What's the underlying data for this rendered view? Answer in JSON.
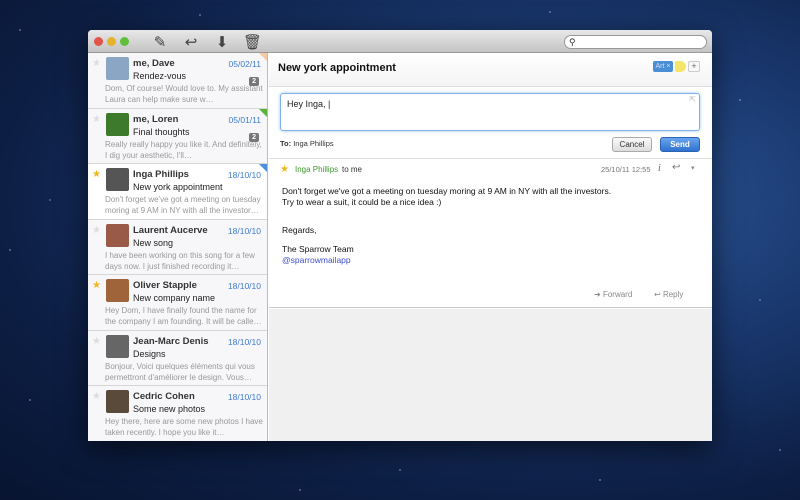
{
  "toolbar": {
    "icons": [
      "compose-icon",
      "reply-icon",
      "archive-icon",
      "trash-icon"
    ],
    "search_placeholder": ""
  },
  "messages": [
    {
      "from": "me, Dave",
      "date": "05/02/11",
      "subject": "Rendez-vous",
      "preview": "Dom, Of course! Would love to. My assistant Laura can help make sure w…",
      "count": "2",
      "starred": false,
      "flag": "#f4c9a3",
      "avatar": "#8aa6c4"
    },
    {
      "from": "me, Loren",
      "date": "05/01/11",
      "subject": "Final thoughts",
      "preview": "Really really happy you like it. And definitely, I dig your aesthetic, I'll…",
      "count": "2",
      "starred": false,
      "flag": "#58b33c",
      "avatar": "#3d7a2c"
    },
    {
      "from": "Inga Phillips",
      "date": "18/10/10",
      "subject": "New york appointment",
      "preview": "Don't forget we've got a meeting on tuesday moring at 9 AM in NY with all the investor…",
      "starred": true,
      "flag": "#4a90e2",
      "avatar": "#555",
      "selected": true
    },
    {
      "from": "Laurent Aucerve",
      "date": "18/10/10",
      "subject": "New song",
      "preview": "I have been working on this song for a few days now. I just finished recording it…",
      "starred": false,
      "avatar": "#9a5a48"
    },
    {
      "from": "Oliver Stapple",
      "date": "18/10/10",
      "subject": "New company name",
      "preview": "Hey Dom, I have finally found the name for the company I am founding. It will be calle…",
      "starred": true,
      "avatar": "#a0643a"
    },
    {
      "from": "Jean-Marc Denis",
      "date": "18/10/10",
      "subject": "Designs",
      "preview": "Bonjour, Voici quelques éléments qui vous permettront d'améliorer le design. Vous…",
      "starred": false,
      "avatar": "#666"
    },
    {
      "from": "Cedric Cohen",
      "date": "18/10/10",
      "subject": "Some new photos",
      "preview": "Hey there, here are some new photos I have taken recently. I hope you like it…",
      "starred": false,
      "avatar": "#5a4a3a"
    }
  ],
  "thread": {
    "title": "New york appointment",
    "tag": "Art ×",
    "add": "+",
    "compose": {
      "text": "Hey Inga, |",
      "to_label": "To:",
      "to": "Inga Phillips",
      "cancel": "Cancel",
      "send": "Send"
    },
    "message": {
      "sender": "Inga Phillips",
      "to": "to me",
      "date": "25/10/11 12:55",
      "lines": [
        "Don't forget we've got a meeting on tuesday moring at 9 AM in NY with all the investors.",
        "Try to wear a suit, it could be a nice idea :)",
        "",
        "Regards,",
        "",
        "The Sparrow Team"
      ],
      "link": "@sparrowmailapp",
      "forward": "Forward",
      "reply": "Reply"
    }
  },
  "colors": {
    "accent": "#3f7ad0",
    "send": "#3a80d8",
    "sender": "#3c9a2a",
    "star": "#f3b51a"
  }
}
